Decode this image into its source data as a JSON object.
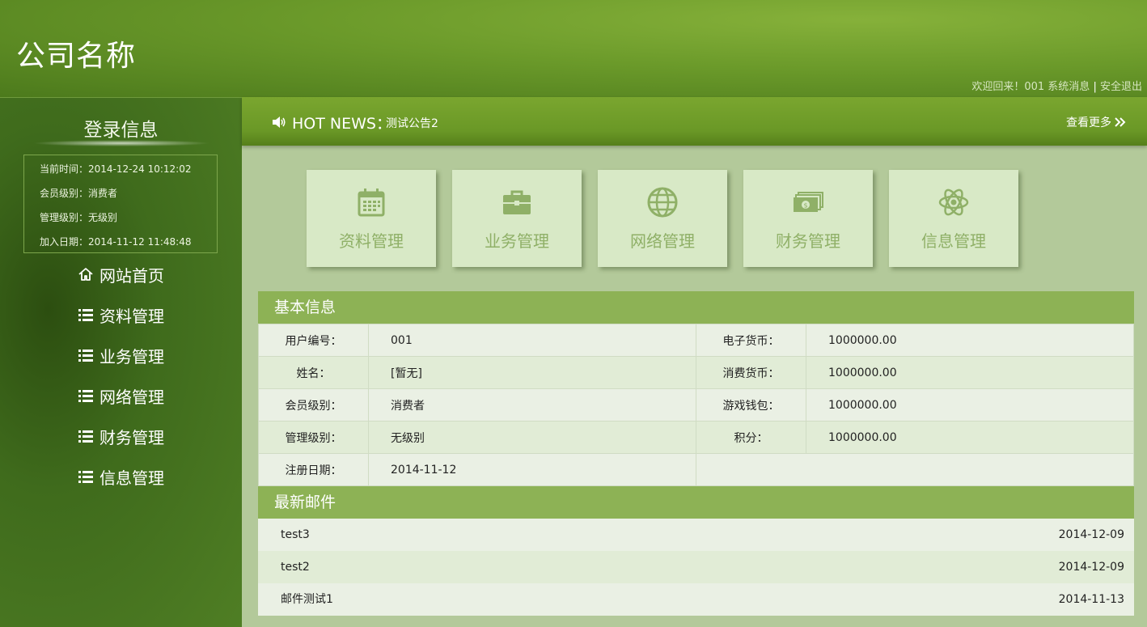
{
  "header": {
    "company_name": "公司名称",
    "welcome": "欢迎回来！001",
    "messages": "系统消息",
    "separator": "|",
    "logout": "安全退出"
  },
  "sidebar": {
    "title": "登录信息",
    "login_info": [
      {
        "label": "当前时间：",
        "value": "2014-12-24 10:12:02"
      },
      {
        "label": "会员级别：",
        "value": "消费者"
      },
      {
        "label": "管理级别：",
        "value": "无级别"
      },
      {
        "label": "加入日期：",
        "value": "2014-11-12 11:48:48"
      }
    ],
    "menu": [
      {
        "label": "网站首页",
        "icon": "home-icon"
      },
      {
        "label": "资料管理",
        "icon": "list-icon"
      },
      {
        "label": "业务管理",
        "icon": "list-icon"
      },
      {
        "label": "网络管理",
        "icon": "list-icon"
      },
      {
        "label": "财务管理",
        "icon": "list-icon"
      },
      {
        "label": "信息管理",
        "icon": "list-icon"
      }
    ]
  },
  "news": {
    "label": "HOT NEWS：",
    "headline": "测试公告2",
    "more": "查看更多"
  },
  "tiles": [
    {
      "label": "资料管理",
      "icon": "calendar-icon"
    },
    {
      "label": "业务管理",
      "icon": "briefcase-icon"
    },
    {
      "label": "网络管理",
      "icon": "globe-icon"
    },
    {
      "label": "财务管理",
      "icon": "money-icon"
    },
    {
      "label": "信息管理",
      "icon": "atom-icon"
    }
  ],
  "basic_info": {
    "title": "基本信息",
    "rows": [
      {
        "l1": "用户编号：",
        "v1": "001",
        "l2": "电子货币：",
        "v2": "1000000.00"
      },
      {
        "l1": "姓名：",
        "v1": "[暂无]",
        "l2": "消费货币：",
        "v2": "1000000.00"
      },
      {
        "l1": "会员级别：",
        "v1": "消费者",
        "l2": "游戏钱包：",
        "v2": "1000000.00"
      },
      {
        "l1": "管理级别：",
        "v1": "无级别",
        "l2": "积分：",
        "v2": "1000000.00"
      },
      {
        "l1": "注册日期：",
        "v1": "2014-11-12",
        "l2": "",
        "v2": ""
      }
    ]
  },
  "mail": {
    "title": "最新邮件",
    "items": [
      {
        "subject": "test3",
        "date": "2014-12-09"
      },
      {
        "subject": "test2",
        "date": "2014-12-09"
      },
      {
        "subject": "邮件测试1",
        "date": "2014-11-13"
      }
    ]
  },
  "colors": {
    "header_green": "#6b9a2a",
    "sidebar_dark": "#3f6b1c",
    "panel_head": "#8db255",
    "tile_bg": "#d8e9c6",
    "tile_icon": "#8fb067",
    "content_bg": "#b3c99a"
  }
}
